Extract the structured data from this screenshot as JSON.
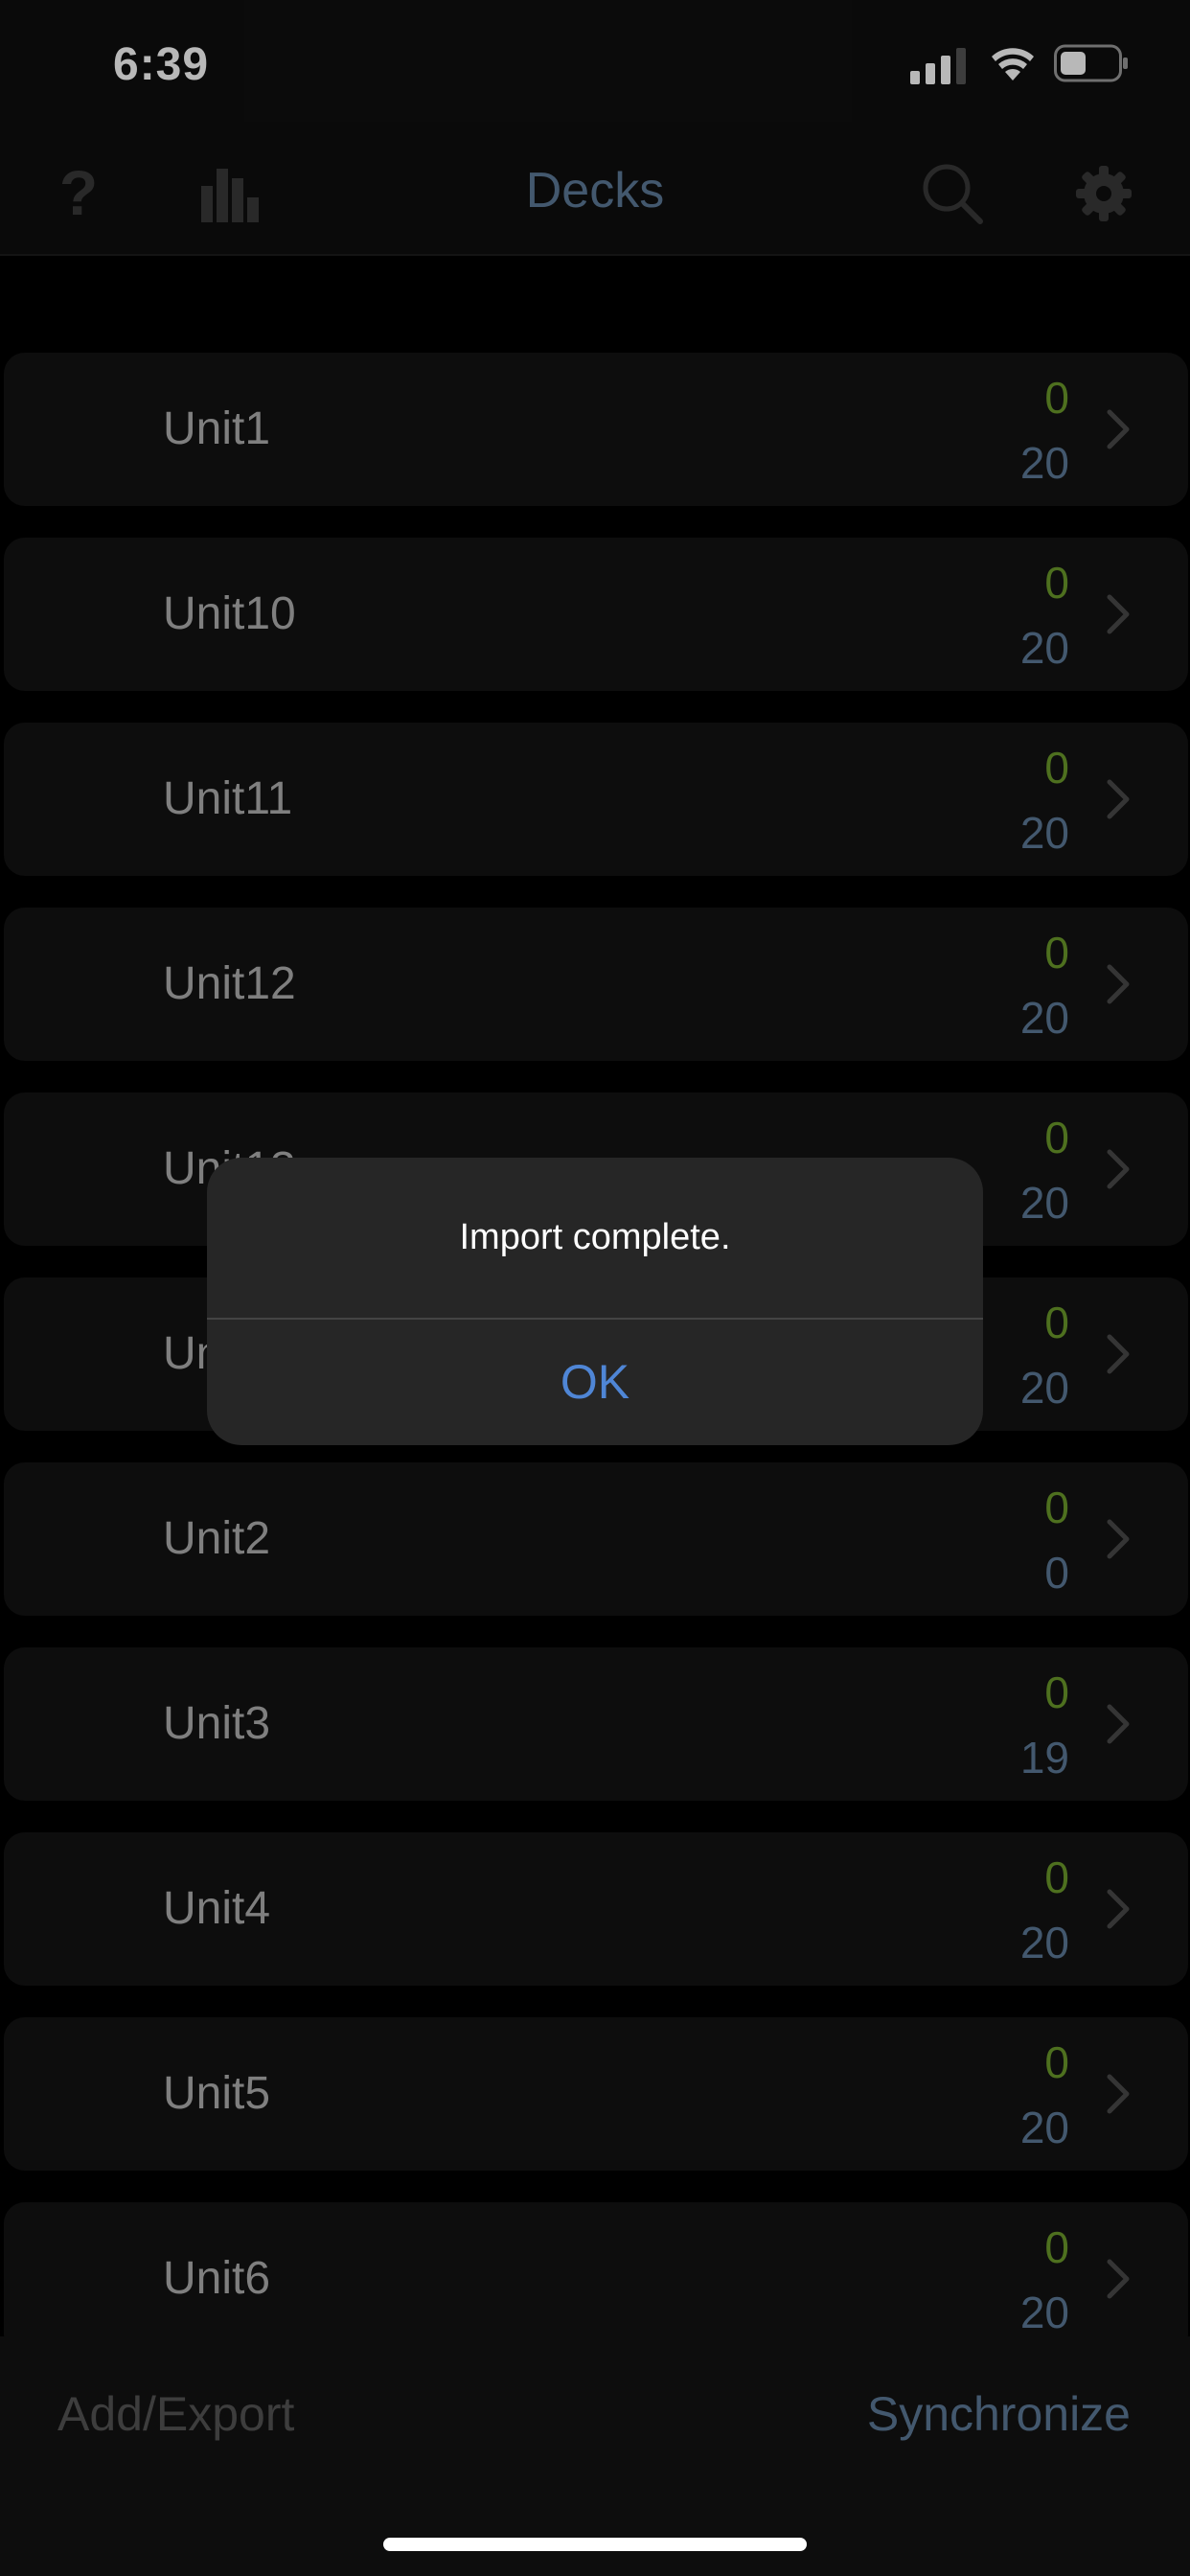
{
  "status_bar": {
    "time": "6:39",
    "icons": [
      "signal-icon",
      "wifi-icon",
      "battery-icon"
    ]
  },
  "nav": {
    "title": "Decks",
    "left_icons": [
      "help-icon",
      "stats-icon"
    ],
    "right_icons": [
      "search-icon",
      "gear-icon"
    ]
  },
  "decks": [
    {
      "name": "Unit1",
      "new": "0",
      "due": "20"
    },
    {
      "name": "Unit10",
      "new": "0",
      "due": "20"
    },
    {
      "name": "Unit11",
      "new": "0",
      "due": "20"
    },
    {
      "name": "Unit12",
      "new": "0",
      "due": "20"
    },
    {
      "name": "Unit13",
      "new": "0",
      "due": "20"
    },
    {
      "name": "Unit14",
      "new": "0",
      "due": "20"
    },
    {
      "name": "Unit2",
      "new": "0",
      "due": "0"
    },
    {
      "name": "Unit3",
      "new": "0",
      "due": "19"
    },
    {
      "name": "Unit4",
      "new": "0",
      "due": "20"
    },
    {
      "name": "Unit5",
      "new": "0",
      "due": "20"
    },
    {
      "name": "Unit6",
      "new": "0",
      "due": "20"
    }
  ],
  "alert": {
    "message": "Import complete.",
    "ok_label": "OK"
  },
  "toolbar": {
    "add_export_label": "Add/Export",
    "synchronize_label": "Synchronize"
  },
  "colors": {
    "new_count": "#6c9b2c",
    "due_count": "#5d7b99",
    "accent": "#4f86d6"
  }
}
